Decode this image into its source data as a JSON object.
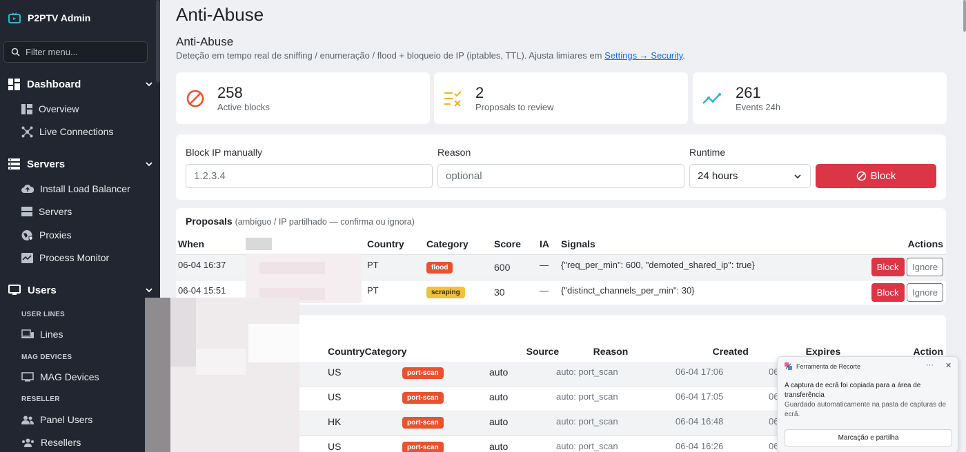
{
  "sidebar": {
    "brand": "P2PTV Admin",
    "filter_placeholder": "Filter menu...",
    "sections": {
      "dashboard": "Dashboard",
      "servers": "Servers",
      "users": "Users"
    },
    "items": {
      "overview": "Overview",
      "live_connections": "Live Connections",
      "install_lb": "Install Load Balancer",
      "servers": "Servers",
      "proxies": "Proxies",
      "process_monitor": "Process Monitor",
      "lines": "Lines",
      "mag_devices": "MAG Devices",
      "panel_users": "Panel Users",
      "resellers": "Resellers"
    },
    "groups": {
      "user_lines": "USER LINES",
      "mag_devices": "MAG DEVICES",
      "reseller": "RESELLER"
    }
  },
  "page": {
    "title": "Anti-Abuse",
    "subtitle": "Anti-Abuse",
    "description": "Deteção em tempo real de sniffing / enumeração / flood + bloqueio de IP (iptables, TTL). Ajusta limiares em ",
    "settings_link": "Settings → Security",
    "description_end": "."
  },
  "stats": [
    {
      "value": "258",
      "label": "Active blocks",
      "color": "#e8522f"
    },
    {
      "value": "2",
      "label": "Proposals to review",
      "color": "#f0b429"
    },
    {
      "value": "261",
      "label": "Events 24h",
      "color": "#2fb7c9"
    }
  ],
  "block_form": {
    "ip_label": "Block IP manually",
    "ip_placeholder": "1.2.3.4",
    "reason_label": "Reason",
    "reason_placeholder": "optional",
    "runtime_label": "Runtime",
    "runtime_value": "24 hours",
    "submit_label": "Block"
  },
  "proposals": {
    "title": "Proposals",
    "hint": "(ambíguo / IP partilhado — confirma ou ignora)",
    "columns": [
      "When",
      "Country",
      "Category",
      "Score",
      "IA",
      "Signals",
      "Actions"
    ],
    "rows": [
      {
        "when": "06-04 16:37",
        "country": "PT",
        "category": "flood",
        "cat_color": "#e8522f",
        "score": "600",
        "ia": "—",
        "signals": "{\"req_per_min\": 600, \"demoted_shared_ip\": true}"
      },
      {
        "when": "06-04 15:51",
        "country": "PT",
        "category": "scraping",
        "cat_color": "#f0c040",
        "score": "30",
        "ia": "—",
        "signals": "{\"distinct_channels_per_min\": 30}"
      }
    ],
    "block_label": "Block",
    "ignore_label": "Ignore"
  },
  "blocks": {
    "columns": [
      "Country",
      "Category",
      "Source",
      "Reason",
      "Created",
      "Expires",
      "Action"
    ],
    "rows": [
      {
        "country": "US",
        "category": "port-scan",
        "source": "auto",
        "reason": "auto: port_scan",
        "created": "06-04 17:06",
        "expires": "06"
      },
      {
        "country": "US",
        "category": "port-scan",
        "source": "auto",
        "reason": "auto: port_scan",
        "created": "06-04 17:05",
        "expires": "06"
      },
      {
        "country": "HK",
        "category": "port-scan",
        "source": "auto",
        "reason": "auto: port_scan",
        "created": "06-04 16:48",
        "expires": "06"
      },
      {
        "country": "US",
        "category": "port-scan",
        "source": "auto",
        "reason": "auto: port_scan",
        "created": "06-04 16:26",
        "expires": "06"
      }
    ]
  },
  "toast": {
    "app": "Ferramenta de Recorte",
    "more": "···",
    "close": "✕",
    "message": "A captura de ecrã foi copiada para a área de transferência",
    "detail": "Guardado automaticamente na pasta de capturas de ecrã.",
    "action": "Marcação e partilha"
  }
}
